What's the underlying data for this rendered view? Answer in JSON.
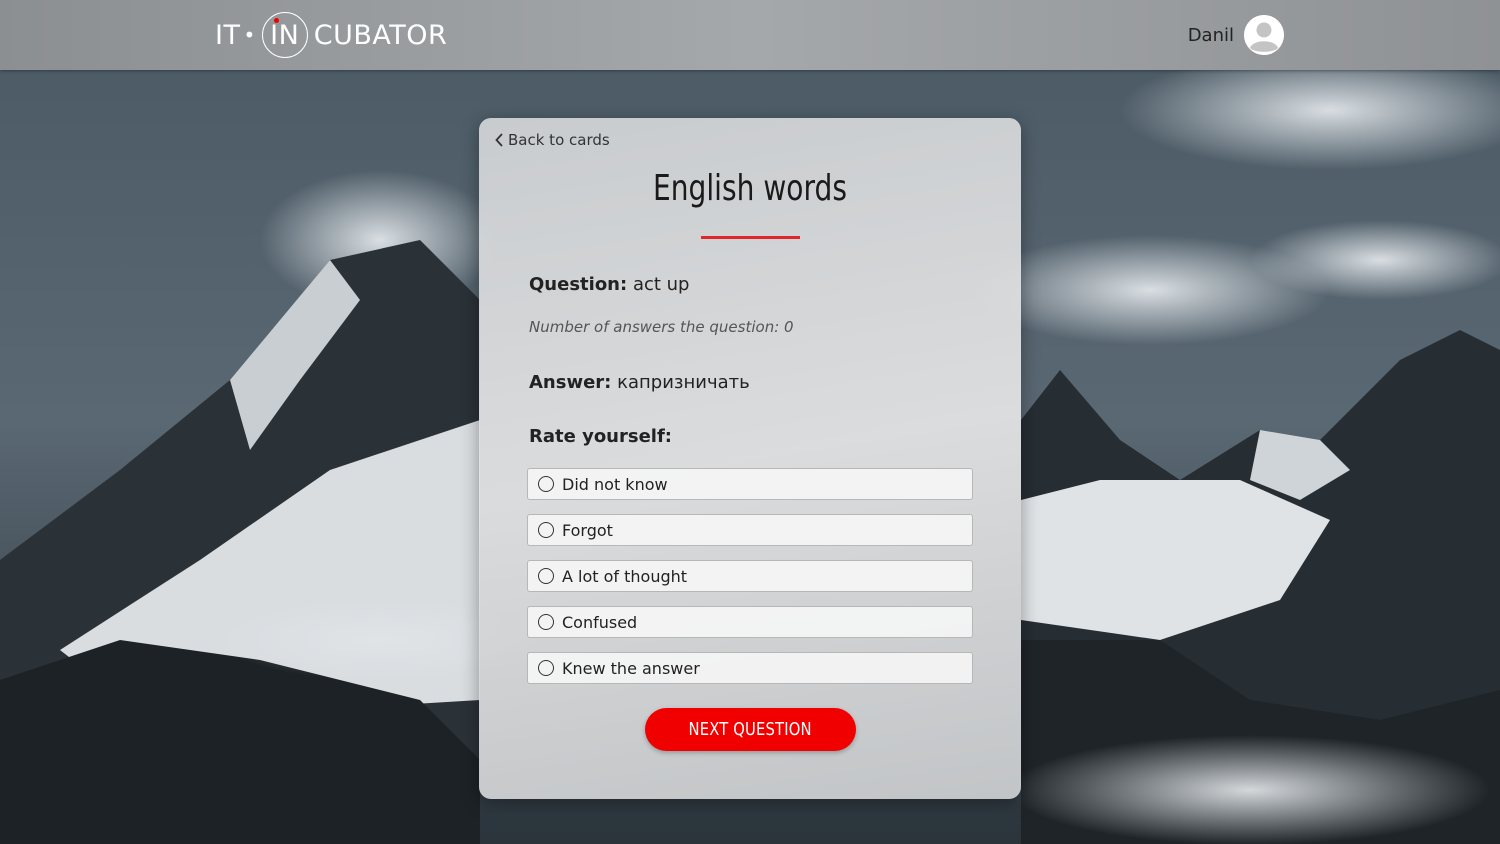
{
  "header": {
    "logo": {
      "left": "IT",
      "middle": "IN",
      "right": "CUBATOR"
    },
    "user_name": "Danil"
  },
  "card": {
    "back_label": "Back to cards",
    "title": "English words",
    "question_label": "Question:",
    "question_value": "act up",
    "answers_count_text": "Number of answers the question: 0",
    "answer_label": "Answer:",
    "answer_value": "капризничать",
    "rate_label": "Rate yourself:",
    "options": [
      {
        "label": "Did not know"
      },
      {
        "label": "Forgot"
      },
      {
        "label": "A lot of thought"
      },
      {
        "label": "Confused"
      },
      {
        "label": "Knew the answer"
      }
    ],
    "next_label": "NEXT QUESTION"
  },
  "colors": {
    "accent": "#f10000",
    "underline": "#e0262a"
  }
}
